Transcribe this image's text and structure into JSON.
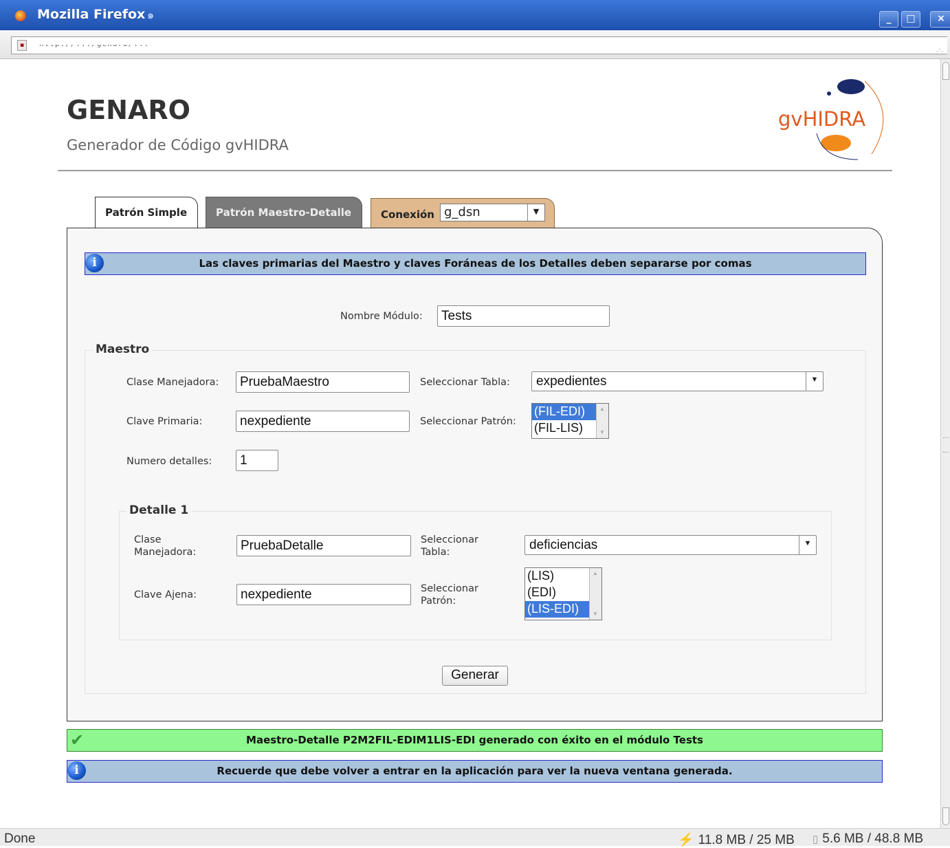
{
  "window": {
    "title": "Mozilla Firefox",
    "minimize": "_",
    "maximize": "□",
    "close": "×"
  },
  "addressbar": {
    "url": "http://.../genaro/..."
  },
  "statusbar": {
    "status": "Done",
    "mem1": "11.8 MB / 25 MB",
    "mem2": "5.6 MB / 48.8 MB"
  },
  "header": {
    "title": "GENARO",
    "subtitle": "Generador de Código gvHIDRA",
    "logo_text": "gvHIDRA"
  },
  "tabs": {
    "simple": "Patrón Simple",
    "maestro_detalle": "Patrón Maestro-Detalle",
    "conexion_label": "Conexión",
    "conexion_value": "g_dsn"
  },
  "info_top": "Las claves primarias del Maestro y claves Foráneas de los Detalles deben separarse por comas",
  "modulo": {
    "label": "Nombre Módulo:",
    "value": "Tests"
  },
  "maestro": {
    "legend": "Maestro",
    "clase_label": "Clase Manejadora:",
    "clase_value": "PruebaMaestro",
    "clave_label": "Clave Primaria:",
    "clave_value": "nexpediente",
    "numdet_label": "Numero detalles:",
    "numdet_value": "1",
    "tabla_label": "Seleccionar Tabla:",
    "tabla_value": "expedientes",
    "patron_label": "Seleccionar Patrón:",
    "patron_options": [
      "(FIL-EDI)",
      "(FIL-LIS)"
    ],
    "patron_selected": "(FIL-EDI)"
  },
  "detalle": {
    "legend": "Detalle 1",
    "clase_label_1": "Clase",
    "clase_label_2": "Manejadora:",
    "clase_value": "PruebaDetalle",
    "clave_label": "Clave Ajena:",
    "clave_value": "nexpediente",
    "tabla_label_1": "Seleccionar",
    "tabla_label_2": "Tabla:",
    "tabla_value": "deficiencias",
    "patron_label_1": "Seleccionar",
    "patron_label_2": "Patrón:",
    "patron_options": [
      "(LIS)",
      "(EDI)",
      "(LIS-EDI)"
    ],
    "patron_selected": "(LIS-EDI)"
  },
  "generar": "Generar",
  "success_msg": "Maestro-Detalle P2M2FIL-EDIM1LIS-EDI generado con éxito en el módulo Tests",
  "info_bottom": "Recuerde que debe volver a entrar en la aplicación para ver la nueva ventana generada.",
  "colors": {
    "info_bg": "#a9c3dc",
    "success_bg": "#8ff78f",
    "tab_md": "#7a7a7a",
    "tab_conn": "#e0b98e",
    "list_selected": "#3f7ad9"
  }
}
